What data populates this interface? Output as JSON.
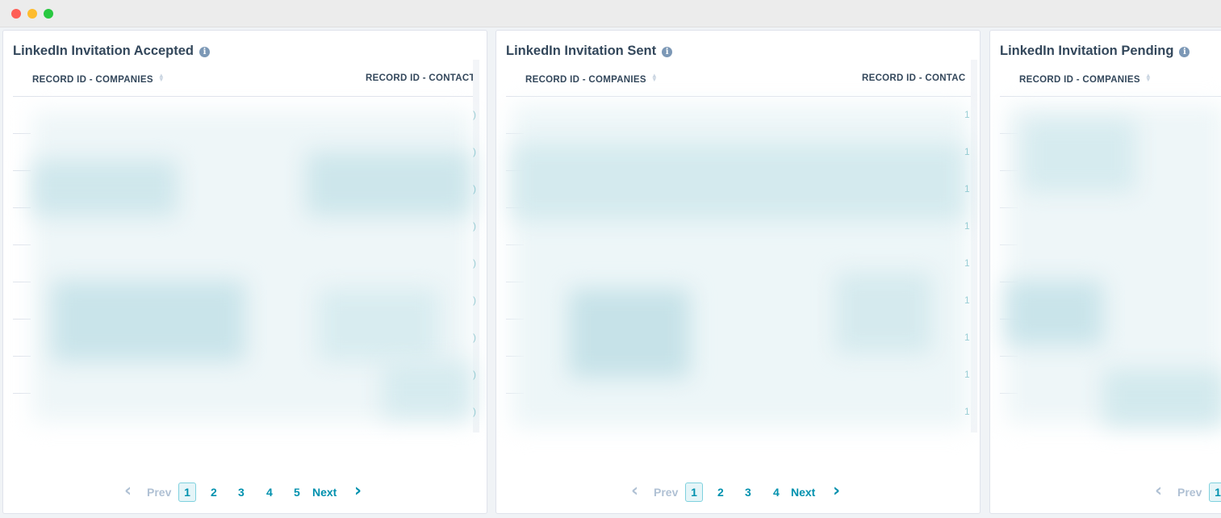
{
  "window": {
    "controls": [
      "close",
      "minimize",
      "zoom"
    ]
  },
  "cards": [
    {
      "title": "LinkedIn Invitation Accepted",
      "columns": [
        "RECORD ID - COMPANIES",
        "RECORD ID - CONTACT"
      ],
      "pagination": {
        "prev": "Prev",
        "pages": [
          "1",
          "2",
          "3",
          "4",
          "5"
        ],
        "current": "1",
        "next": "Next"
      }
    },
    {
      "title": "LinkedIn Invitation Sent",
      "columns": [
        "RECORD ID - COMPANIES",
        "RECORD ID - CONTAC"
      ],
      "pagination": {
        "prev": "Prev",
        "pages": [
          "1",
          "2",
          "3",
          "4"
        ],
        "current": "1",
        "next": "Next"
      }
    },
    {
      "title": "LinkedIn Invitation Pending",
      "columns": [
        "RECORD ID - COMPANIES"
      ],
      "pagination": {
        "prev": "Prev",
        "pages": [
          "1"
        ],
        "current": "1"
      }
    }
  ],
  "edge_digits": {
    "card1": ")",
    "card2": "1"
  },
  "colors": {
    "accent": "#0091ae",
    "heading": "#33475b",
    "border": "#dfe3eb",
    "blur_tint": "#cfe7ec"
  },
  "icons": {
    "info": "info-icon",
    "sort": "sort-icon",
    "prev": "chevron-left-icon",
    "next": "chevron-right-icon"
  }
}
